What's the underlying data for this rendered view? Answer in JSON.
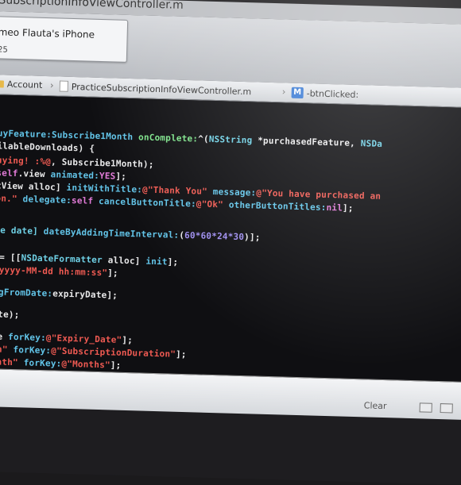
{
  "window": {
    "title": "eSubscriptionInfoViewController.m"
  },
  "toolbar": {
    "device_name": "meo Flauta's iPhone",
    "device_sub": "25"
  },
  "jumpbar": {
    "group": "Account",
    "file": "PracticeSubscriptionInfoViewController.m",
    "method_badge": "M",
    "method": "-btnClicked:"
  },
  "editor": {
    "lines": [
      {
        "segments": [
          {
            "text": " buyFeature:",
            "color": "method"
          },
          {
            "text": "Subscribe1Month ",
            "color": "method"
          },
          {
            "text": "onComplete:",
            "color": "green"
          },
          {
            "text": "^(",
            "color": "plain"
          },
          {
            "text": "NSString ",
            "color": "class"
          },
          {
            "text": "*purchasedFeature, ",
            "color": "plain"
          },
          {
            "text": "NSDa",
            "color": "class"
          }
        ]
      },
      {
        "segments": [
          {
            "text": "vailableDownloads) {",
            "color": "plain"
          }
        ]
      },
      {
        "segments": [
          {
            "text": " buying! :%@",
            "color": "string"
          },
          {
            "text": ", Subscribe1Month);",
            "color": "plain"
          }
        ]
      },
      {
        "segments": [
          {
            "text": "ew",
            "color": "plain"
          },
          {
            "text": "self",
            "color": "pink"
          },
          {
            "text": ".view ",
            "color": "plain"
          },
          {
            "text": "animated:",
            "color": "method"
          },
          {
            "text": "YES",
            "color": "pink"
          },
          {
            "text": "];",
            "color": "plain"
          }
        ]
      },
      {
        "segments": [
          {
            "text": "ertView alloc] ",
            "color": "plain"
          },
          {
            "text": "initWithTitle:",
            "color": "method"
          },
          {
            "text": "@\"Thank You\" ",
            "color": "string"
          },
          {
            "text": "message:",
            "color": "method"
          },
          {
            "text": "@\"You have purchased an",
            "color": "string"
          }
        ]
      },
      {
        "segments": [
          {
            "text": "tion.\" ",
            "color": "string"
          },
          {
            "text": "delegate:",
            "color": "method"
          },
          {
            "text": "self ",
            "color": "pink"
          },
          {
            "text": "cancelButtonTitle:",
            "color": "method"
          },
          {
            "text": "@\"Ok\" ",
            "color": "string"
          },
          {
            "text": "otherButtonTitles:",
            "color": "method"
          },
          {
            "text": "nil",
            "color": "pink"
          },
          {
            "text": "];",
            "color": "plain"
          }
        ]
      },
      {
        "segments": [
          {
            "text": "Date date] ",
            "color": "class"
          },
          {
            "text": "dateByAddingTimeInterval:",
            "color": "method"
          },
          {
            "text": "(",
            "color": "plain"
          },
          {
            "text": "60*60*24*30",
            "color": "number"
          },
          {
            "text": ")];",
            "color": "plain"
          }
        ]
      },
      {
        "segments": [
          {
            "text": "at = [[",
            "color": "plain"
          },
          {
            "text": "NSDateFormatter ",
            "color": "class"
          },
          {
            "text": "alloc] ",
            "color": "plain"
          },
          {
            "text": "init",
            "color": "method"
          },
          {
            "text": "];",
            "color": "plain"
          }
        ]
      },
      {
        "segments": [
          {
            "text": ":@\"yyyy-MM-dd hh:mm:ss\"",
            "color": "string"
          },
          {
            "text": "];",
            "color": "plain"
          }
        ]
      },
      {
        "segments": [
          {
            "text": "ringFromDate:",
            "color": "method"
          },
          {
            "text": "expiryDate];",
            "color": "plain"
          }
        ]
      },
      {
        "segments": [
          {
            "text": "rdate);",
            "color": "plain"
          }
        ]
      },
      {
        "segments": [
          {
            "text": "date ",
            "color": "plain"
          },
          {
            "text": "forKey:",
            "color": "method"
          },
          {
            "text": "@\"Expiry_Date\"",
            "color": "string"
          },
          {
            "text": "];",
            "color": "plain"
          }
        ]
      },
      {
        "segments": [
          {
            "text": " nth\" ",
            "color": "string"
          },
          {
            "text": "forKey:",
            "color": "method"
          },
          {
            "text": "@\"SubscriptionDuration\"",
            "color": "string"
          },
          {
            "text": "];",
            "color": "plain"
          }
        ]
      },
      {
        "segments": [
          {
            "text": " Month\" ",
            "color": "string"
          },
          {
            "text": "forKey:",
            "color": "method"
          },
          {
            "text": "@\"Months\"",
            "color": "string"
          },
          {
            "text": "];",
            "color": "plain"
          }
        ]
      }
    ]
  },
  "debug": {
    "clear_label": "Clear"
  }
}
